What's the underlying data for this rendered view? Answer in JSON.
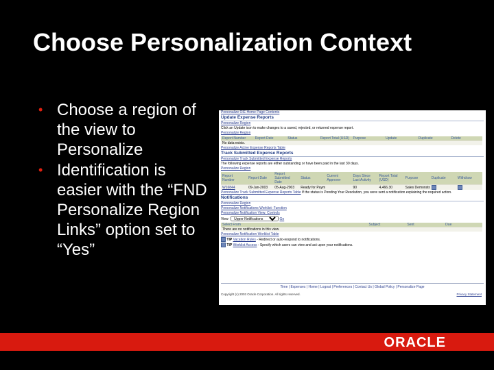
{
  "slide": {
    "title": "Choose Personalization Context",
    "bullets": [
      "Choose a region of the view to Personalize",
      "Identification is easier with the “FND Personalize Region Links” option set to “Yes”"
    ],
    "bullet_color": "#e02010",
    "band_color": "#d81a0f",
    "logo_text": "ORACLE"
  },
  "screenshot": {
    "top_link": "Personalize OIE Home Page Contents",
    "update": {
      "header": "Update Expense Reports",
      "link1": "Personalize Region",
      "note": "Click an Update icon to make changes to a saved, rejected, or returned expense report.",
      "link2": "Personalize Region",
      "columns": [
        "Report Number",
        "Report Date",
        "Status",
        "Report Total (USD)",
        "Purpose",
        "Update",
        "Duplicate",
        "Delete"
      ],
      "empty": "No data exists.",
      "table_link": "Personalize Active Expense Reports Table"
    },
    "track": {
      "header": "Track Submitted Expense Reports",
      "link1": "Personalize Track Submitted Expense Reports",
      "note": "The following expense reports are either outstanding or have been paid in the last 30 days.",
      "link2": "Personalize Region",
      "columns": [
        "Report Number",
        "Report Date",
        "Report Submitted Date",
        "Status",
        "Current Approver",
        "Days Since Last Activity",
        "Report Total (USD)",
        "Purpose",
        "Duplicate",
        "Withdraw"
      ],
      "row": [
        "W16844",
        "09-Jan-2003",
        "05-Aug-2003",
        "Ready for Payment",
        "",
        "90",
        "4,466.30",
        "Sales Demonstration ...",
        "",
        ""
      ],
      "table_link": "Personalize Track Submitted Expense Reports Table",
      "tip": "If the status is Pending Your Resolution, you were sent a notification explaining the required action."
    },
    "notifications": {
      "header": "Notifications",
      "link1": "Personalize Region",
      "link2": "Personalize Notifications Worklist: Function",
      "link3": "Personalize Notification View: Controls",
      "view_label": "View",
      "view_value": "Upper Notifications",
      "go": "Go",
      "columns": [
        "Select From",
        "Subject",
        "Sent",
        "Due"
      ],
      "empty": "There are no notifications in this view.",
      "table_link": "Personalize Notification Worklist Table",
      "tip1_label": "TIP",
      "tip1_link": "Vacation Rules",
      "tip1_text": "- Redirect or auto-respond to notifications.",
      "tip2_label": "TIP",
      "tip2_link": "Worklist Access",
      "tip2_text": "- Specify which users can view and act upon your notifications."
    },
    "footer_links": "Time | Expenses | Home | Logout | Preferences | Contact Us | Global Policy | Personalize Page",
    "copyright": "Copyright (c) 2003 Oracle Corporation. All rights reserved.",
    "privacy": "Privacy Statement"
  }
}
